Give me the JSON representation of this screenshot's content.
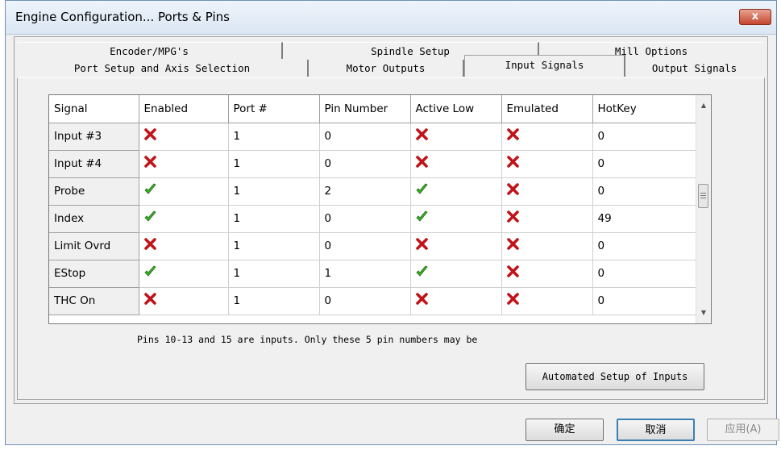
{
  "window": {
    "title": "Engine Configuration... Ports & Pins",
    "close_label": "x"
  },
  "tabs": {
    "row_top": [
      {
        "label": "Encoder/MPG's"
      },
      {
        "label": "Spindle Setup"
      },
      {
        "label": "Mill Options"
      }
    ],
    "row_bottom": [
      {
        "label": "Port Setup and Axis Selection"
      },
      {
        "label": "Motor Outputs"
      },
      {
        "label": "Input Signals",
        "active": true
      },
      {
        "label": "Output Signals"
      }
    ]
  },
  "grid": {
    "columns": [
      "Signal",
      "Enabled",
      "Port #",
      "Pin Number",
      "Active Low",
      "Emulated",
      "HotKey"
    ],
    "rows": [
      {
        "signal": "Input #3",
        "enabled": "red-x-icon",
        "port": "1",
        "pin": "0",
        "active_low": "red-x-icon",
        "emulated": "red-x-icon",
        "hotkey": "0"
      },
      {
        "signal": "Input #4",
        "enabled": "red-x-icon",
        "port": "1",
        "pin": "0",
        "active_low": "red-x-icon",
        "emulated": "red-x-icon",
        "hotkey": "0"
      },
      {
        "signal": "Probe",
        "enabled": "green-check-icon",
        "port": "1",
        "pin": "2",
        "active_low": "green-check-icon",
        "emulated": "red-x-icon",
        "hotkey": "0"
      },
      {
        "signal": "Index",
        "enabled": "green-check-icon",
        "port": "1",
        "pin": "0",
        "active_low": "green-check-icon",
        "emulated": "red-x-icon",
        "hotkey": "49"
      },
      {
        "signal": "Limit Ovrd",
        "enabled": "red-x-icon",
        "port": "1",
        "pin": "0",
        "active_low": "red-x-icon",
        "emulated": "red-x-icon",
        "hotkey": "0"
      },
      {
        "signal": "EStop",
        "enabled": "green-check-icon",
        "port": "1",
        "pin": "1",
        "active_low": "green-check-icon",
        "emulated": "red-x-icon",
        "hotkey": "0"
      },
      {
        "signal": "THC On",
        "enabled": "red-x-icon",
        "port": "1",
        "pin": "0",
        "active_low": "red-x-icon",
        "emulated": "red-x-icon",
        "hotkey": "0"
      }
    ]
  },
  "note": "Pins 10-13 and 15 are inputs. Only these 5 pin numbers may be",
  "buttons": {
    "automated": "Automated Setup of Inputs",
    "ok": "确定",
    "cancel": "取消",
    "apply": "应用(A)"
  },
  "colors": {
    "check": "#3fae2a",
    "cross": "#c0141a",
    "title_bg": "#dbe6f3"
  }
}
